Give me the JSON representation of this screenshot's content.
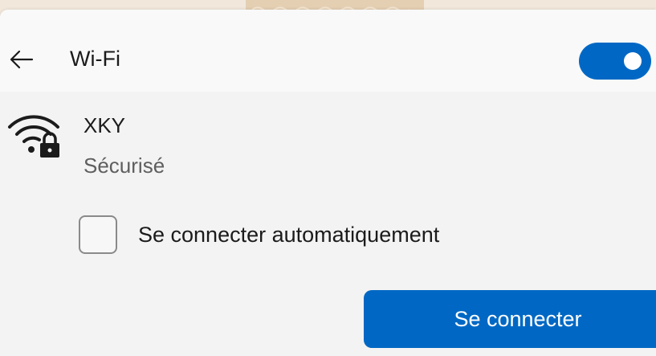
{
  "header": {
    "back_icon": "arrow-left-icon",
    "title": "Wi-Fi",
    "wifi_enabled": true
  },
  "network": {
    "icon": "wifi-secured-icon",
    "name": "XKY",
    "status": "Sécurisé"
  },
  "auto_connect": {
    "label": "Se connecter automatiquement",
    "checked": false
  },
  "connect_button": {
    "label": "Se connecter"
  },
  "colors": {
    "accent": "#0068c4",
    "panel": "#f3f3f3",
    "header": "#f9f9f9",
    "page_background": "#f1e8db",
    "tape": "#e5cfb3"
  }
}
